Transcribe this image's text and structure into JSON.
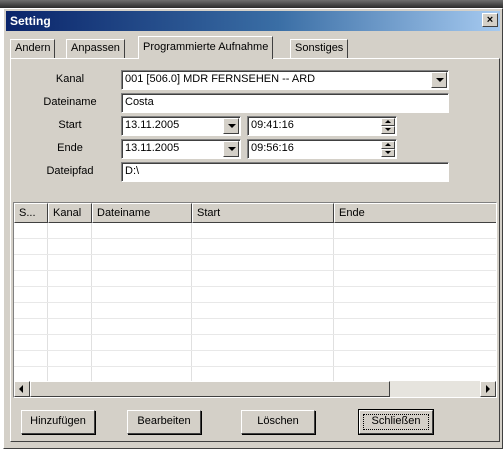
{
  "window": {
    "title": "Setting",
    "close_glyph": "×"
  },
  "tabs": [
    {
      "label": "Andern"
    },
    {
      "label": "Anpassen"
    },
    {
      "label": "Programmierte Aufnahme"
    },
    {
      "label": "Sonstiges"
    }
  ],
  "form": {
    "kanal_label": "Kanal",
    "kanal_value": "001 [506.0] MDR FERNSEHEN -- ARD",
    "dateiname_label": "Dateiname",
    "dateiname_value": "Costa",
    "start_label": "Start",
    "start_date": "13.11.2005",
    "start_time": "09:41:16",
    "ende_label": "Ende",
    "ende_date": "13.11.2005",
    "ende_time": "09:56:16",
    "dateipfad_label": "Dateipfad",
    "dateipfad_value": "D:\\"
  },
  "list": {
    "columns": [
      "S...",
      "Kanal",
      "Dateiname",
      "Start",
      "Ende"
    ],
    "rows": []
  },
  "buttons": {
    "add": "Hinzufügen",
    "edit": "Bearbeiten",
    "delete": "Löschen",
    "close": "Schließen"
  }
}
